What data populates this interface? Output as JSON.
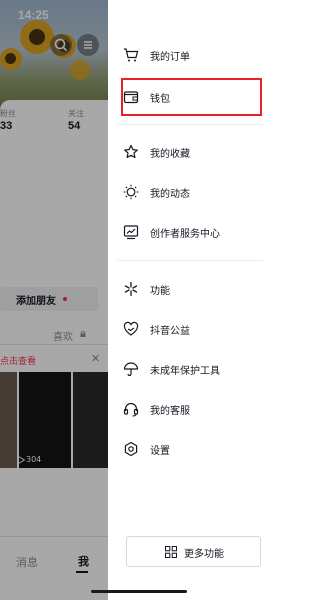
{
  "status_bar": {
    "time": "14:25"
  },
  "profile": {
    "stats": [
      {
        "label": "粉丝",
        "value": "33"
      },
      {
        "label": "关注",
        "value": "54"
      }
    ],
    "add_friend_label": "添加朋友",
    "like_tab_label": "喜欢",
    "notice_text": "点击查看",
    "play_count": "304",
    "tabs": {
      "messages": "消息",
      "me": "我"
    }
  },
  "drawer": {
    "items": [
      {
        "label": "我的订单",
        "icon": "cart-icon"
      },
      {
        "label": "钱包",
        "icon": "wallet-icon",
        "highlighted": true
      },
      {
        "label": "我的收藏",
        "icon": "star-icon"
      },
      {
        "label": "我的动态",
        "icon": "sun-icon"
      },
      {
        "label": "创作者服务中心",
        "icon": "creator-chart-icon"
      },
      {
        "label": "功能",
        "icon": "sparkle-icon"
      },
      {
        "label": "抖音公益",
        "icon": "heart-hands-icon"
      },
      {
        "label": "未成年保护工具",
        "icon": "umbrella-icon"
      },
      {
        "label": "我的客服",
        "icon": "headset-icon"
      },
      {
        "label": "设置",
        "icon": "settings-icon"
      }
    ],
    "more_button_label": "更多功能"
  },
  "colors": {
    "highlight_border": "#e8202a",
    "accent_red": "#fe2c55",
    "text": "#161823",
    "secondary_text": "#8a8b91"
  }
}
